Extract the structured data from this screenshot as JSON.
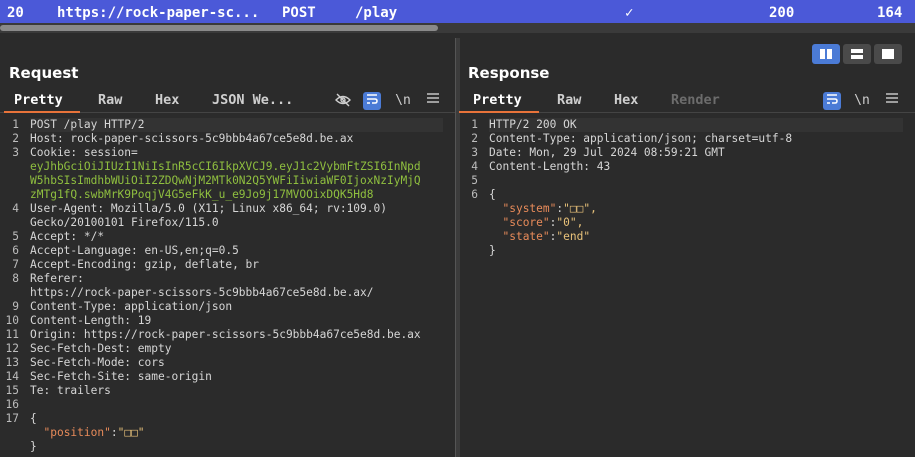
{
  "history": {
    "index": "20",
    "url": "https://rock-paper-sc...",
    "method": "POST",
    "path": "/play",
    "check": "✓",
    "status": "200",
    "length": "164"
  },
  "request": {
    "title": "Request",
    "tabs": [
      "Pretty",
      "Raw",
      "Hex",
      "JSON We..."
    ],
    "lines": [
      {
        "n": "1",
        "text": "POST /play HTTP/2"
      },
      {
        "n": "2",
        "text": "Host: rock-paper-scissors-5c9bbb4a67ce5e8d.be.ax"
      },
      {
        "n": "3",
        "text": "Cookie: session="
      },
      {
        "n": "",
        "text": "eyJhbGciOiJIUzI1NiIsInR5cCI6IkpXVCJ9.eyJ1c2VybmFtZSI6InNpd"
      },
      {
        "n": "",
        "text": "W5hbSIsImdhbWUiOiI2ZDQwNjM2MTk0N2Q5YWFiIiwiaWF0IjoxNzIyMjQ"
      },
      {
        "n": "",
        "text": "zMTg1fQ.swbMrK9PoqjV4G5eFkK_u_e9Jo9j17MVOOixDQK5Hd8"
      },
      {
        "n": "4",
        "text": "User-Agent: Mozilla/5.0 (X11; Linux x86_64; rv:109.0)"
      },
      {
        "n": "",
        "text": "Gecko/20100101 Firefox/115.0"
      },
      {
        "n": "5",
        "text": "Accept: */*"
      },
      {
        "n": "6",
        "text": "Accept-Language: en-US,en;q=0.5"
      },
      {
        "n": "7",
        "text": "Accept-Encoding: gzip, deflate, br"
      },
      {
        "n": "8",
        "text": "Referer:"
      },
      {
        "n": "",
        "text": "https://rock-paper-scissors-5c9bbb4a67ce5e8d.be.ax/"
      },
      {
        "n": "9",
        "text": "Content-Type: application/json"
      },
      {
        "n": "10",
        "text": "Content-Length: 19"
      },
      {
        "n": "11",
        "text": "Origin: https://rock-paper-scissors-5c9bbb4a67ce5e8d.be.ax"
      },
      {
        "n": "12",
        "text": "Sec-Fetch-Dest: empty"
      },
      {
        "n": "13",
        "text": "Sec-Fetch-Mode: cors"
      },
      {
        "n": "14",
        "text": "Sec-Fetch-Site: same-origin"
      },
      {
        "n": "15",
        "text": "Te: trailers"
      },
      {
        "n": "16",
        "text": ""
      },
      {
        "n": "17",
        "text": "{"
      },
      {
        "n": "",
        "text": "  \"position\":\"□□\""
      },
      {
        "n": "",
        "text": "}"
      }
    ]
  },
  "response": {
    "title": "Response",
    "tabs": [
      "Pretty",
      "Raw",
      "Hex",
      "Render"
    ],
    "lines": [
      {
        "n": "1",
        "text": "HTTP/2 200 OK"
      },
      {
        "n": "2",
        "text": "Content-Type: application/json; charset=utf-8"
      },
      {
        "n": "3",
        "text": "Date: Mon, 29 Jul 2024 08:59:21 GMT"
      },
      {
        "n": "4",
        "text": "Content-Length: 43"
      },
      {
        "n": "5",
        "text": ""
      },
      {
        "n": "6",
        "text": "{"
      },
      {
        "n": "",
        "text": "  \"system\":\"□□\","
      },
      {
        "n": "",
        "text": "  \"score\":\"0\","
      },
      {
        "n": "",
        "text": "  \"state\":\"end\""
      },
      {
        "n": "",
        "text": "}"
      }
    ]
  },
  "icons": {
    "hide": "eye-slash-icon",
    "wrap": "wrap-lines-icon",
    "newline": "\\n",
    "menu": "hamburger-menu-icon"
  },
  "colors": {
    "accent": "#4b59d8",
    "tab_underline": "#e8733a",
    "cookie_value": "#8fbf3f",
    "json_key": "#e88b5a"
  }
}
